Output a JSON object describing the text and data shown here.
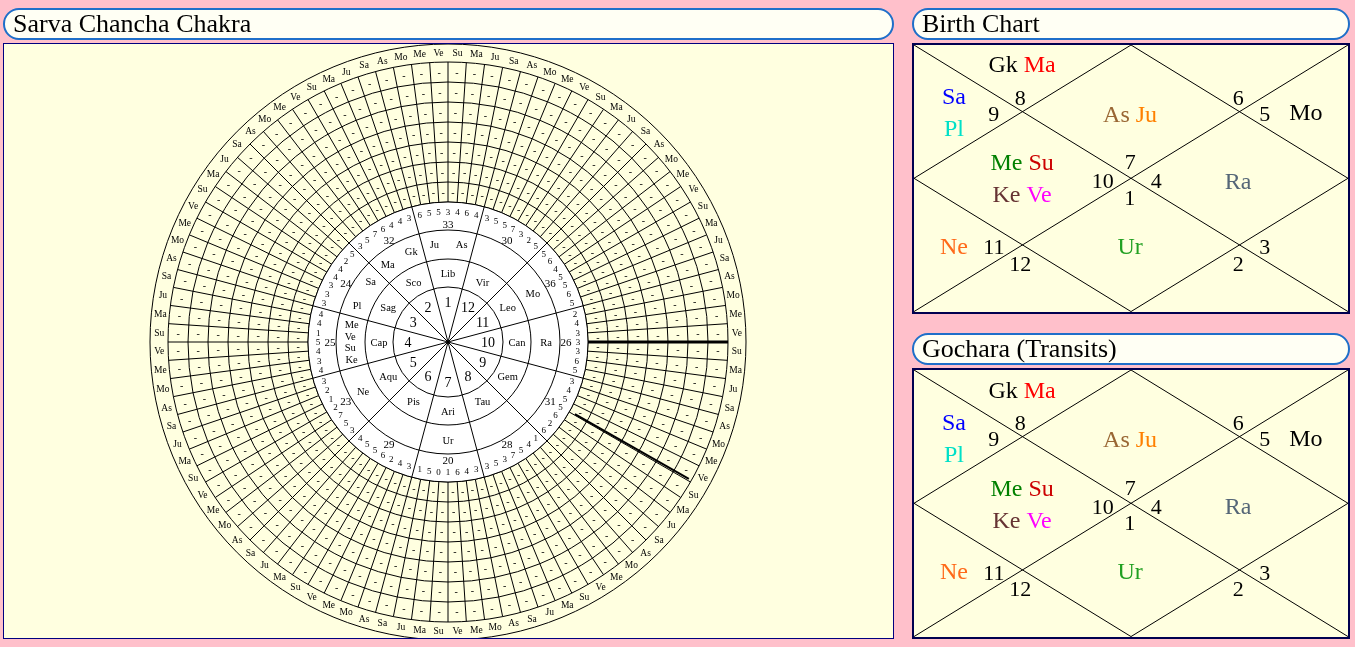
{
  "chakra": {
    "title": "Sarva Chancha Chakra",
    "outer_labels": {
      "top": [
        "As",
        "Mo",
        "Me",
        "Ve",
        "Su",
        "Ma",
        "Ju",
        "Sa",
        "As",
        "Mo",
        "Me",
        "Ve",
        "Su",
        "Ma",
        "Ju",
        "Sa",
        "As",
        "Mo",
        "Me",
        "Ve",
        "Su",
        "Ma",
        "Ju",
        "Sa"
      ],
      "right": [
        "As",
        "Mo",
        "Me",
        "Ve",
        "Su",
        "Ma",
        "Ju",
        "Sa",
        "As",
        "Mo",
        "Me",
        "Ve",
        "Su",
        "Ma",
        "Ju",
        "Sa",
        "As",
        "Mo",
        "Me",
        "Ve",
        "Su",
        "Ma",
        "Ju",
        "Sa"
      ],
      "bottom": [
        "Sa",
        "Ju",
        "Ma",
        "Su",
        "Ve",
        "Me",
        "Mo",
        "As",
        "Sa",
        "Ju",
        "Ma",
        "Su",
        "Ve",
        "Me",
        "Mo",
        "As",
        "Sa",
        "Ju",
        "Ma",
        "Su",
        "Ve",
        "Me",
        "Mo",
        "As"
      ],
      "left": [
        "Sa",
        "Ju",
        "Ma",
        "Su",
        "Ve",
        "Me",
        "Mo",
        "As",
        "Sa",
        "Ju",
        "Ma",
        "Su",
        "Ve",
        "Me",
        "Mo",
        "As",
        "Sa",
        "Ju",
        "Ma",
        "Su",
        "Ve",
        "Me",
        "Mo",
        "As"
      ]
    },
    "grid_rings": [
      {
        "top": [
          "-",
          "-",
          "-",
          "-",
          "-",
          "-",
          "-",
          "-",
          "-",
          "-",
          "-",
          "-",
          "-",
          "-",
          "-",
          "-",
          "-",
          "-",
          "-",
          "-",
          "-",
          "-",
          "-",
          "-"
        ],
        "right": [
          "-",
          "-",
          "-",
          "-",
          "-",
          "-",
          "-",
          "-",
          "-",
          "-",
          "-",
          "-",
          "-",
          "-",
          "-",
          "-",
          "-",
          "-",
          "-",
          "-",
          "-",
          "-",
          "-",
          "-"
        ],
        "bottom": [
          "-",
          "-",
          "-",
          "-",
          "-",
          "-",
          "-",
          "-",
          "-",
          "-",
          "-",
          "-",
          "-",
          "-",
          "-",
          "-",
          "-",
          "-",
          "-",
          "-",
          "-",
          "-",
          "-",
          "-"
        ],
        "left": [
          "-",
          "-",
          "-",
          "-",
          "-",
          "-",
          "-",
          "-",
          "-",
          "-",
          "-",
          "-",
          "-",
          "-",
          "-",
          "-",
          "-",
          "-",
          "-",
          "-",
          "-",
          "-",
          "-",
          "-"
        ]
      },
      {
        "top": [
          "-",
          "-",
          "-",
          "-",
          "-",
          "-",
          "-",
          "-",
          "-",
          "-",
          "-",
          "-",
          "-",
          "-",
          "-",
          "-",
          "-",
          "-",
          "-",
          "-",
          "-",
          "-",
          "-",
          "-"
        ],
        "right": [
          "-",
          "-",
          "-",
          "-",
          "-",
          "-",
          "-",
          "-",
          "-",
          "-",
          "-",
          "-",
          "-",
          "-",
          "-",
          "-",
          "-",
          "-",
          "-",
          "-",
          "-",
          "-",
          "-",
          "-"
        ],
        "bottom": [
          "-",
          "-",
          "-",
          "-",
          "-",
          "-",
          "-",
          "-",
          "-",
          "-",
          "-",
          "-",
          "-",
          "-",
          "-",
          "-",
          "-",
          "-",
          "-",
          "-",
          "-",
          "-",
          "-",
          "-"
        ],
        "left": [
          "-",
          "-",
          "-",
          "-",
          "-",
          "-",
          "-",
          "-",
          "-",
          "-",
          "-",
          "-",
          "-",
          "-",
          "-",
          "-",
          "-",
          "-",
          "-",
          "-",
          "-",
          "-",
          "-",
          "-"
        ]
      },
      {
        "top": [
          "-",
          "-",
          "-",
          "-",
          "-",
          "-",
          "-",
          "-",
          "-",
          "-",
          "-",
          "-",
          "-",
          "-",
          "-",
          "-",
          "-",
          "-",
          "-",
          "-",
          "-",
          "-",
          "-",
          "-"
        ],
        "right": [
          "-",
          "-",
          "-",
          "-",
          "-",
          "-",
          "-",
          "-",
          "-",
          "-",
          "-",
          "-",
          "-",
          "-",
          "-",
          "-",
          "-",
          "-",
          "-",
          "-",
          "-",
          "-",
          "-",
          "-"
        ],
        "bottom": [
          "-",
          "-",
          "-",
          "-",
          "-",
          "-",
          "-",
          "-",
          "-",
          "-",
          "-",
          "-",
          "-",
          "-",
          "-",
          "-",
          "-",
          "-",
          "-",
          "-",
          "-",
          "-",
          "-",
          "-"
        ],
        "left": [
          "-",
          "-",
          "-",
          "-",
          "-",
          "-",
          "-",
          "-",
          "-",
          "-",
          "-",
          "-",
          "-",
          "-",
          "-",
          "-",
          "-",
          "-",
          "-",
          "-",
          "-",
          "-",
          "-",
          "-"
        ]
      },
      {
        "top": [
          "-",
          "-",
          "-",
          "-",
          "-",
          "-",
          "-",
          "-",
          "-",
          "-",
          "-",
          "-",
          "-",
          "-",
          "-",
          "-",
          "-",
          "-",
          "-",
          "-",
          "-",
          "-",
          "-",
          "-"
        ],
        "right": [
          "-",
          "-",
          "-",
          "-",
          "-",
          "-",
          "-",
          "-",
          "-",
          "-",
          "-",
          "-",
          "-",
          "-",
          "-",
          "-",
          "-",
          "-",
          "-",
          "-",
          "-",
          "-",
          "-",
          "-"
        ],
        "bottom": [
          "-",
          "-",
          "-",
          "-",
          "-",
          "-",
          "-",
          "-",
          "-",
          "-",
          "-",
          "-",
          "-",
          "-",
          "-",
          "-",
          "-",
          "-",
          "-",
          "-",
          "-",
          "-",
          "-",
          "-"
        ],
        "left": [
          "-",
          "-",
          "-",
          "-",
          "-",
          "-",
          "-",
          "-",
          "-",
          "-",
          "-",
          "-",
          "-",
          "-",
          "-",
          "-",
          "-",
          "-",
          "-",
          "-",
          "-",
          "-",
          "-",
          "-"
        ]
      },
      {
        "top": [
          "-",
          "-",
          "-",
          "-",
          "-",
          "-",
          "-",
          "-",
          "-",
          "-",
          "-",
          "-",
          "-",
          "-",
          "-",
          "-",
          "-",
          "-",
          "-",
          "-",
          "-",
          "-",
          "-",
          "-"
        ],
        "right": [
          "-",
          "-",
          "-",
          "-",
          "-",
          "-",
          "-",
          "-",
          "-",
          "-",
          "-",
          "-",
          "-",
          "-",
          "-",
          "-",
          "-",
          "-",
          "-",
          "-",
          "-",
          "-",
          "-",
          "-"
        ],
        "bottom": [
          "-",
          "-",
          "-",
          "-",
          "-",
          "-",
          "-",
          "-",
          "-",
          "-",
          "-",
          "-",
          "-",
          "-",
          "-",
          "-",
          "-",
          "-",
          "-",
          "-",
          "-",
          "-",
          "-",
          "-"
        ],
        "left": [
          "-",
          "-",
          "-",
          "-",
          "-",
          "-",
          "-",
          "-",
          "-",
          "-",
          "-",
          "-",
          "-",
          "-",
          "-",
          "-",
          "-",
          "-",
          "-",
          "-",
          "-",
          "-",
          "-",
          "-"
        ]
      },
      {
        "top": [
          "-",
          "-",
          "-",
          "-",
          "-",
          "-",
          "-",
          "-",
          "-",
          "-",
          "-",
          "-",
          "-",
          "-",
          "-",
          "-",
          "-",
          "-",
          "-",
          "-",
          "-",
          "-",
          "-",
          "-"
        ],
        "right": [
          "-",
          "-",
          "-",
          "-",
          "-",
          "-",
          "-",
          "-",
          "-",
          "-",
          "-",
          "-",
          "-",
          "-",
          "-",
          "-",
          "-",
          "-",
          "-",
          "-",
          "-",
          "-",
          "-",
          "-"
        ],
        "bottom": [
          "-",
          "-",
          "-",
          "-",
          "-",
          "-",
          "-",
          "-",
          "-",
          "-",
          "-",
          "-",
          "-",
          "-",
          "-",
          "-",
          "-",
          "-",
          "-",
          "-",
          "-",
          "-",
          "-",
          "-"
        ],
        "left": [
          "-",
          "-",
          "-",
          "-",
          "-",
          "-",
          "-",
          "-",
          "-",
          "-",
          "-",
          "-",
          "-",
          "-",
          "-",
          "-",
          "-",
          "-",
          "-",
          "-",
          "-",
          "-",
          "-",
          "-"
        ]
      },
      {
        "top": [
          "-",
          "-",
          "-",
          "-",
          "-",
          "-",
          "-",
          "-",
          "-",
          "-",
          "-",
          "-",
          "-",
          "-",
          "-",
          "-",
          "-",
          "-",
          "-",
          "-",
          "-",
          "-",
          "-",
          "-"
        ],
        "right": [
          "-",
          "-",
          "-",
          "-",
          "-",
          "-",
          "-",
          "-",
          "-",
          "-",
          "-",
          "-",
          "-",
          "-",
          "-",
          "-",
          "-",
          "-",
          "-",
          "-",
          "-",
          "-",
          "-",
          "-"
        ],
        "bottom": [
          "-",
          "-",
          "-",
          "-",
          "-",
          "-",
          "-",
          "-",
          "-",
          "-",
          "-",
          "-",
          "-",
          "-",
          "-",
          "-",
          "-",
          "-",
          "-",
          "-",
          "-",
          "-",
          "-",
          "-"
        ],
        "left": [
          "-",
          "-",
          "-",
          "-",
          "-",
          "-",
          "-",
          "-",
          "-",
          "-",
          "-",
          "-",
          "-",
          "-",
          "-",
          "-",
          "-",
          "-",
          "-",
          "-",
          "-",
          "-",
          "-",
          "-"
        ]
      }
    ],
    "sectors": [
      {
        "house": "1",
        "sign": "Lib",
        "planets": [
          "Ju",
          "As"
        ],
        "digits": [
          "6",
          "5",
          "5",
          "3",
          "4",
          "6",
          "4"
        ],
        "total": "33"
      },
      {
        "house": "12",
        "sign": "Vir",
        "digits": [
          "3",
          "5",
          "5",
          "7",
          "3",
          "2",
          "5"
        ],
        "total": "30"
      },
      {
        "house": "11",
        "sign": "Leo",
        "planets": [
          "Mo"
        ],
        "digits": [
          "5",
          "6",
          "4",
          "5",
          "5",
          "6",
          "5"
        ],
        "total": "36"
      },
      {
        "house": "10",
        "sign": "Can",
        "planets": [
          "Ra"
        ],
        "digits": [
          "2",
          "4",
          "3",
          "3",
          "3",
          "6",
          "5"
        ],
        "total": "26"
      },
      {
        "house": "9",
        "sign": "Gem",
        "digits": [
          "6",
          "2",
          "6",
          "5",
          "5",
          "4",
          "3"
        ],
        "total": "31"
      },
      {
        "house": "8",
        "sign": "Tau",
        "digits": [
          "3",
          "5",
          "3",
          "7",
          "5",
          "4",
          "1"
        ],
        "total": "28"
      },
      {
        "house": "7",
        "sign": "Ari",
        "planets": [
          "Ur"
        ],
        "digits": [
          "1",
          "5",
          "0",
          "1",
          "6",
          "4",
          "3"
        ],
        "total": "20"
      },
      {
        "house": "6",
        "sign": "Pis",
        "digits": [
          "4",
          "5",
          "5",
          "6",
          "2",
          "4",
          "3"
        ],
        "total": "29"
      },
      {
        "house": "5",
        "sign": "Aqu",
        "planets": [
          "Ne"
        ],
        "digits": [
          "3",
          "2",
          "1",
          "2",
          "7",
          "5",
          "3"
        ],
        "total": "23"
      },
      {
        "house": "4",
        "sign": "Cap",
        "planets": [
          "Me",
          "Ve",
          "Su",
          "Ke"
        ],
        "digits": [
          "4",
          "4",
          "1",
          "5",
          "4",
          "3",
          "4"
        ],
        "total": "25"
      },
      {
        "house": "3",
        "sign": "Sag",
        "planets": [
          "Pl",
          "Sa"
        ],
        "digits": [
          "3",
          "3",
          "3",
          "4",
          "4",
          "2",
          "5"
        ],
        "total": "24"
      },
      {
        "house": "2",
        "sign": "Sco",
        "planets": [
          "Ma",
          "Gk"
        ],
        "digits": [
          "3",
          "5",
          "7",
          "6",
          "4",
          "4",
          "3"
        ],
        "total": "32"
      }
    ]
  },
  "birth_chart": {
    "title": "Birth Chart",
    "houses": [
      {
        "sign": "7",
        "planets": [
          {
            "name": "As",
            "color": "#996633"
          },
          {
            "name": "Ju",
            "color": "#ff8000"
          }
        ]
      },
      {
        "sign": "8",
        "planets": [
          {
            "name": "Gk",
            "color": "#000000"
          },
          {
            "name": "Ma",
            "color": "#ff0000"
          }
        ]
      },
      {
        "sign": "9",
        "planets": [
          {
            "name": "Sa",
            "color": "#0000ff"
          },
          {
            "name": "Pl",
            "color": "#00e0c8"
          }
        ]
      },
      {
        "sign": "10",
        "planets": [
          {
            "name": "Me",
            "color": "#008000"
          },
          {
            "name": "Su",
            "color": "#cc0000"
          },
          {
            "name": "Ke",
            "color": "#663333"
          },
          {
            "name": "Ve",
            "color": "#ff00ff"
          }
        ]
      },
      {
        "sign": "11",
        "planets": [
          {
            "name": "Ne",
            "color": "#ff6a1a"
          }
        ]
      },
      {
        "sign": "12"
      },
      {
        "sign": "1",
        "planets": [
          {
            "name": "Ur",
            "color": "#22a022"
          }
        ]
      },
      {
        "sign": "2"
      },
      {
        "sign": "3"
      },
      {
        "sign": "4",
        "planets": [
          {
            "name": "Ra",
            "color": "#556677"
          }
        ]
      },
      {
        "sign": "5",
        "planets": [
          {
            "name": "Mo",
            "color": "#000000"
          }
        ]
      },
      {
        "sign": "6"
      }
    ]
  },
  "transit_chart": {
    "title": "Gochara (Transits)",
    "houses": [
      {
        "sign": "7",
        "planets": [
          {
            "name": "As",
            "color": "#996633"
          },
          {
            "name": "Ju",
            "color": "#ff8000"
          }
        ]
      },
      {
        "sign": "8",
        "planets": [
          {
            "name": "Gk",
            "color": "#000000"
          },
          {
            "name": "Ma",
            "color": "#ff0000"
          }
        ]
      },
      {
        "sign": "9",
        "planets": [
          {
            "name": "Sa",
            "color": "#0000ff"
          },
          {
            "name": "Pl",
            "color": "#00e0c8"
          }
        ]
      },
      {
        "sign": "10",
        "planets": [
          {
            "name": "Me",
            "color": "#008000"
          },
          {
            "name": "Su",
            "color": "#cc0000"
          },
          {
            "name": "Ke",
            "color": "#663333"
          },
          {
            "name": "Ve",
            "color": "#ff00ff"
          }
        ]
      },
      {
        "sign": "11",
        "planets": [
          {
            "name": "Ne",
            "color": "#ff6a1a"
          }
        ]
      },
      {
        "sign": "12"
      },
      {
        "sign": "1",
        "planets": [
          {
            "name": "Ur",
            "color": "#22a022"
          }
        ]
      },
      {
        "sign": "2"
      },
      {
        "sign": "3"
      },
      {
        "sign": "4",
        "planets": [
          {
            "name": "Ra",
            "color": "#556677"
          }
        ]
      },
      {
        "sign": "5",
        "planets": [
          {
            "name": "Mo",
            "color": "#000000"
          }
        ]
      },
      {
        "sign": "6"
      }
    ]
  }
}
